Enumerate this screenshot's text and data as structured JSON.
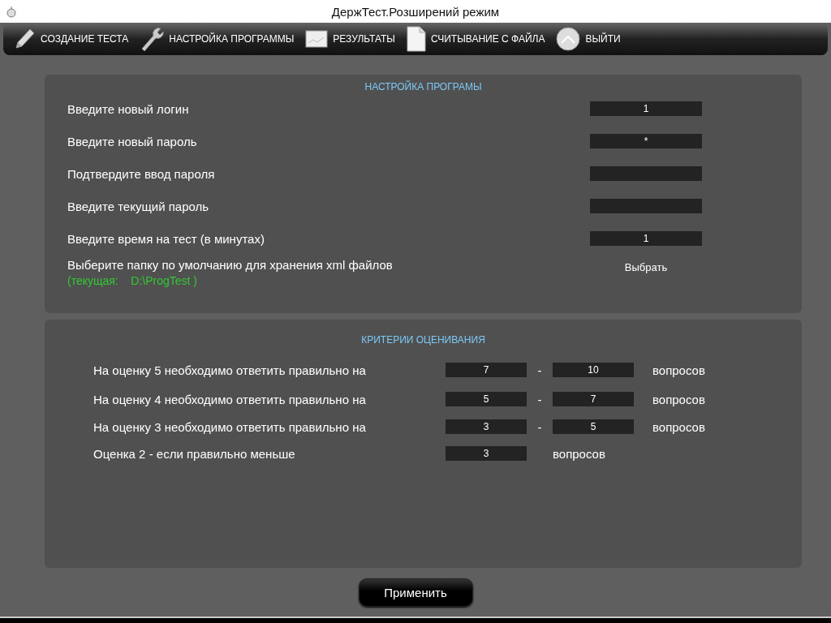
{
  "window": {
    "title": "ДержТест.Розширений режим"
  },
  "toolbar": [
    {
      "label": "СОЗДАНИЕ ТЕСТА",
      "kind": "pencil"
    },
    {
      "label": "НАСТРОЙКА ПРОГРАММЫ",
      "kind": "wrench"
    },
    {
      "label": "РЕЗУЛЬТАТЫ",
      "kind": "sheet"
    },
    {
      "label": "СЧИТЫВАНИЕ С ФАЙЛА",
      "kind": "page"
    },
    {
      "label": "ВЫЙТИ",
      "kind": "orb"
    }
  ],
  "settings": {
    "title": "НАСТРОЙКА ПРОГРАМЫ",
    "fields": [
      {
        "label": "Введите новый логин",
        "value": "1"
      },
      {
        "label": "Введите новый пароль",
        "value": "*"
      },
      {
        "label": "Подтвердите ввод пароля"
      },
      {
        "label": "Введите текущий пароль"
      },
      {
        "label": "Введите время на тест (в минутах)",
        "value": "1"
      }
    ],
    "folder": {
      "label": "Выберите папку по умолчанию для хранения xml файлов",
      "current": "(текущая:    D:\\ProgTest )",
      "button": "Выбрать"
    }
  },
  "criteria": {
    "title": "КРИТЕРИИ ОЦЕНИВАНИЯ",
    "rows": [
      {
        "kind": "range",
        "label": "На оценку 5 необходимо ответить правильно на",
        "from": "7",
        "separator": "-",
        "to": "10",
        "unit": "вопросов"
      },
      {
        "kind": "range",
        "label": "На оценку 4 необходимо ответить правильно на",
        "from": "5",
        "separator": "-",
        "to": "7",
        "unit": "вопросов"
      },
      {
        "kind": "range",
        "label": "На оценку 3 необходимо ответить правильно на",
        "from": "3",
        "separator": "-",
        "to": "5",
        "unit": "вопросов"
      },
      {
        "kind": "single",
        "label": "Оценка 2 -  если правильно меньше",
        "value": "3",
        "unit": "вопросов"
      }
    ]
  },
  "apply_button": "Применить"
}
